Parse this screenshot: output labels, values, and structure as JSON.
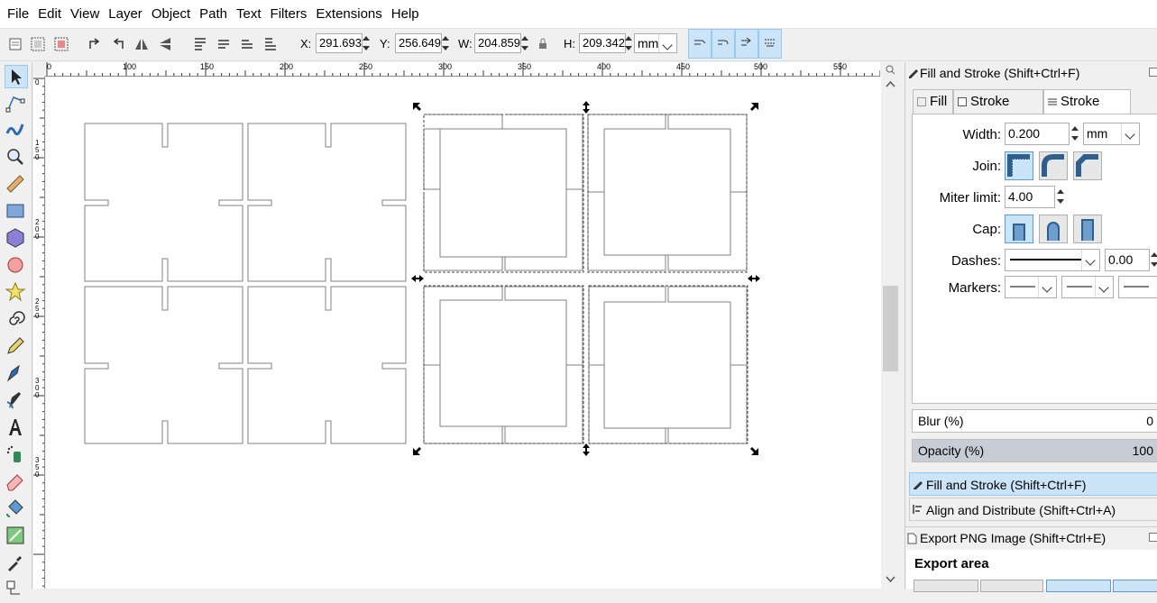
{
  "menu": [
    "File",
    "Edit",
    "View",
    "Layer",
    "Object",
    "Path",
    "Text",
    "Filters",
    "Extensions",
    "Help"
  ],
  "controls": {
    "x_label": "X:",
    "x_value": "291.693",
    "y_label": "Y:",
    "y_value": "256.649",
    "w_label": "W:",
    "w_value": "204.859",
    "h_label": "H:",
    "h_value": "209.342",
    "unit": "mm"
  },
  "ruler": {
    "h_labels": [
      "0",
      "100",
      "150",
      "200",
      "250",
      "300",
      "350",
      "400",
      "450",
      "500",
      "550"
    ],
    "v_labels": [
      "0",
      "150",
      "200",
      "250",
      "300",
      "350"
    ]
  },
  "panel": {
    "dialog_title": "Fill and Stroke (Shift+Ctrl+F)",
    "tabs": [
      "Fill",
      "Stroke paint",
      "Stroke style"
    ],
    "width_label": "Width:",
    "width_value": "0.200",
    "width_unit": "mm",
    "join_label": "Join:",
    "miter_label": "Miter limit:",
    "miter_value": "4.00",
    "cap_label": "Cap:",
    "dashes_label": "Dashes:",
    "dashes_value": "0.00",
    "markers_label": "Markers:",
    "blur_label": "Blur (%)",
    "blur_value": "0",
    "opacity_label": "Opacity (%)",
    "opacity_value": "100",
    "dock_items": [
      "Fill and Stroke (Shift+Ctrl+F)",
      "Align and Distribute (Shift+Ctrl+A)"
    ],
    "export_title": "Export PNG Image (Shift+Ctrl+E)",
    "export_area": "Export area"
  }
}
